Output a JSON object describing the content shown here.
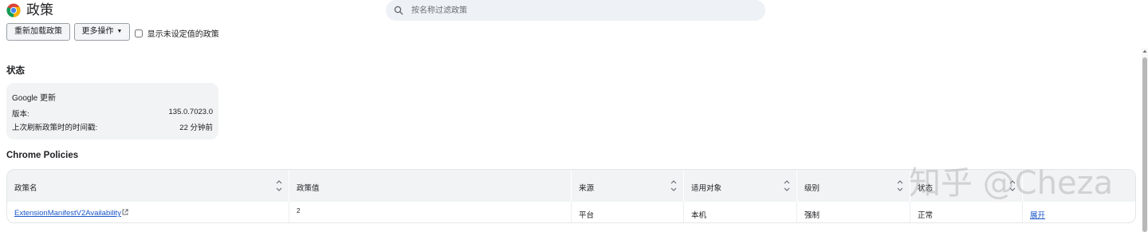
{
  "header": {
    "title": "政策",
    "search_placeholder": "按名称过滤政策"
  },
  "toolbar": {
    "reload_label": "重新加载政策",
    "more_label": "更多操作",
    "show_unset_label": "显示未设定值的政策",
    "show_unset_checked": false
  },
  "status": {
    "section_title": "状态",
    "card_title": "Google 更新",
    "rows": [
      {
        "label": "版本:",
        "value": "135.0.7023.0"
      },
      {
        "label": "上次刷新政策时的时间戳:",
        "value": "22 分钟前"
      }
    ]
  },
  "policies": {
    "section_title": "Chrome Policies",
    "columns": [
      "政策名",
      "政策值",
      "来源",
      "适用对象",
      "级别",
      "状态",
      ""
    ],
    "rows": [
      {
        "name": "ExtensionManifestV2Availability",
        "value": "2",
        "source": "平台",
        "scope": "本机",
        "level": "强制",
        "status": "正常",
        "action": "展开"
      }
    ]
  },
  "watermark": "知乎 @Cheza",
  "icons": {
    "logo": "chrome-logo-icon",
    "search": "search-icon",
    "sort": "sort-icon",
    "external": "external-link-icon"
  },
  "colors": {
    "link": "#1a56c9",
    "card_bg": "#f1f3f4",
    "search_bg": "#eef1f5"
  }
}
